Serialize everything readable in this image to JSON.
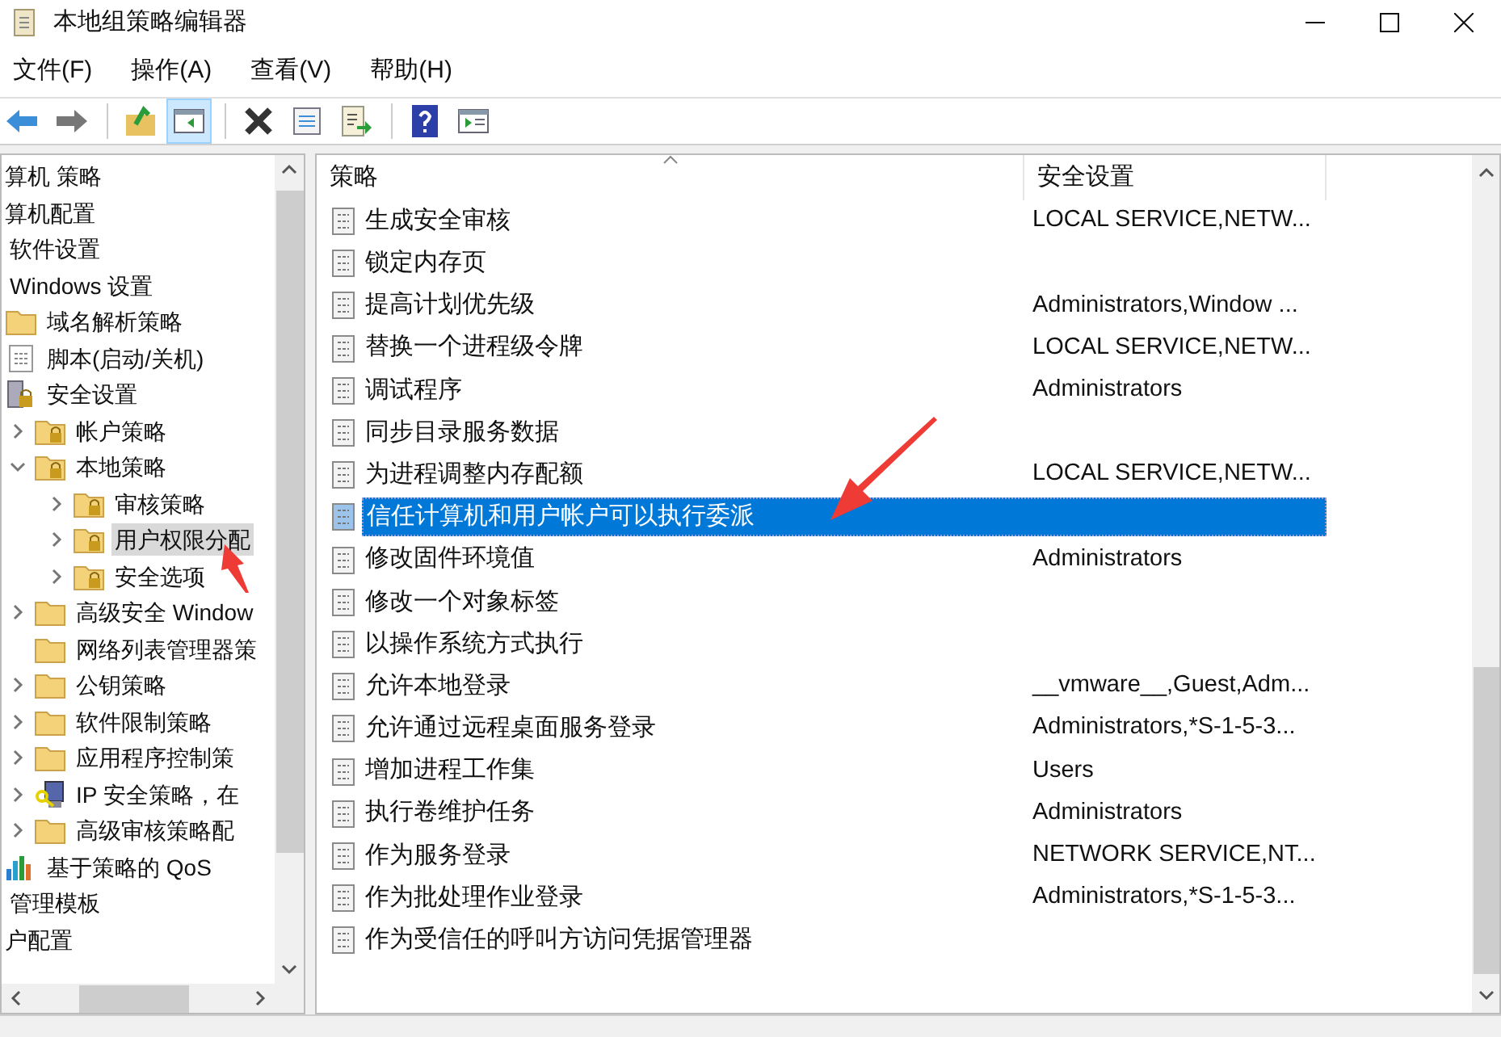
{
  "window": {
    "title": "本地组策略编辑器"
  },
  "menu": [
    "文件(F)",
    "操作(A)",
    "查看(V)",
    "帮助(H)"
  ],
  "toolbar": [
    {
      "pressed": false
    },
    {
      "pressed": false
    },
    {
      "pressed": false
    },
    {
      "pressed": true
    },
    {
      "pressed": false
    },
    {
      "pressed": false
    },
    {
      "pressed": false
    },
    {
      "pressed": false
    },
    {
      "pressed": false
    }
  ],
  "tree": [
    {
      "label": "算机 策略",
      "kind": "none",
      "children": [
        {
          "label": "算机配置",
          "kind": "none",
          "children": [
            {
              "label": "软件设置",
              "kind": "none"
            },
            {
              "label": "Windows 设置",
              "kind": "none",
              "children": [
                {
                  "label": "域名解析策略",
                  "kind": "folder"
                },
                {
                  "label": "脚本(启动/关机)",
                  "kind": "script"
                },
                {
                  "label": "安全设置",
                  "kind": "security",
                  "children": [
                    {
                      "label": "帐户策略",
                      "kind": "locked-folder",
                      "expanded": false,
                      "selected": false
                    },
                    {
                      "label": "本地策略",
                      "kind": "locked-folder",
                      "expanded": true,
                      "selected": false,
                      "children": [
                        {
                          "label": "审核策略",
                          "kind": "locked-folder",
                          "expanded": false,
                          "selected": false
                        },
                        {
                          "label": "用户权限分配",
                          "kind": "locked-folder",
                          "expanded": false,
                          "selected": true
                        },
                        {
                          "label": "安全选项",
                          "kind": "locked-folder",
                          "expanded": false,
                          "selected": false
                        }
                      ]
                    },
                    {
                      "label": "高级安全 Window",
                      "kind": "folder",
                      "expanded": false,
                      "selected": false
                    },
                    {
                      "label": "网络列表管理器策",
                      "kind": "folder",
                      "selected": false
                    },
                    {
                      "label": "公钥策略",
                      "kind": "folder",
                      "expanded": false,
                      "selected": false
                    },
                    {
                      "label": "软件限制策略",
                      "kind": "folder",
                      "expanded": false,
                      "selected": false
                    },
                    {
                      "label": "应用程序控制策",
                      "kind": "folder",
                      "expanded": false,
                      "selected": false
                    },
                    {
                      "label": "IP 安全策略，在",
                      "kind": "network",
                      "expanded": false,
                      "selected": false
                    },
                    {
                      "label": "高级审核策略配",
                      "kind": "folder",
                      "expanded": false,
                      "selected": false
                    }
                  ]
                },
                {
                  "label": "基于策略的 QoS",
                  "kind": "chart"
                }
              ]
            },
            {
              "label": "管理模板",
              "kind": "none"
            }
          ]
        },
        {
          "label": "户配置",
          "kind": "none"
        }
      ]
    }
  ],
  "table": {
    "columns": [
      "策略",
      "安全设置"
    ],
    "rows": [
      {
        "policy": "生成安全审核",
        "setting": "LOCAL SERVICE,NETW...",
        "selected": false
      },
      {
        "policy": "锁定内存页",
        "selected": false
      },
      {
        "policy": "提高计划优先级",
        "setting": "Administrators,Window ...",
        "selected": false
      },
      {
        "policy": "替换一个进程级令牌",
        "setting": "LOCAL SERVICE,NETW...",
        "selected": false
      },
      {
        "policy": "调试程序",
        "setting": "Administrators",
        "selected": false
      },
      {
        "policy": "同步目录服务数据",
        "selected": false
      },
      {
        "policy": "为进程调整内存配额",
        "setting": "LOCAL SERVICE,NETW...",
        "selected": false
      },
      {
        "policy": "信任计算机和用户帐户可以执行委派",
        "selected": true
      },
      {
        "policy": "修改固件环境值",
        "setting": "Administrators",
        "selected": false
      },
      {
        "policy": "修改一个对象标签",
        "selected": false
      },
      {
        "policy": "以操作系统方式执行",
        "selected": false
      },
      {
        "policy": "允许本地登录",
        "setting": "__vmware__,Guest,Adm...",
        "selected": false
      },
      {
        "policy": "允许通过远程桌面服务登录",
        "setting": "Administrators,*S-1-5-3...",
        "selected": false
      },
      {
        "policy": "增加进程工作集",
        "setting": "Users",
        "selected": false
      },
      {
        "policy": "执行卷维护任务",
        "setting": "Administrators",
        "selected": false
      },
      {
        "policy": "作为服务登录",
        "setting": "NETWORK SERVICE,NT...",
        "selected": false
      },
      {
        "policy": "作为批处理作业登录",
        "setting": "Administrators,*S-1-5-3...",
        "selected": false
      },
      {
        "policy": "作为受信任的呼叫方访问凭据管理器",
        "selected": false
      }
    ]
  }
}
